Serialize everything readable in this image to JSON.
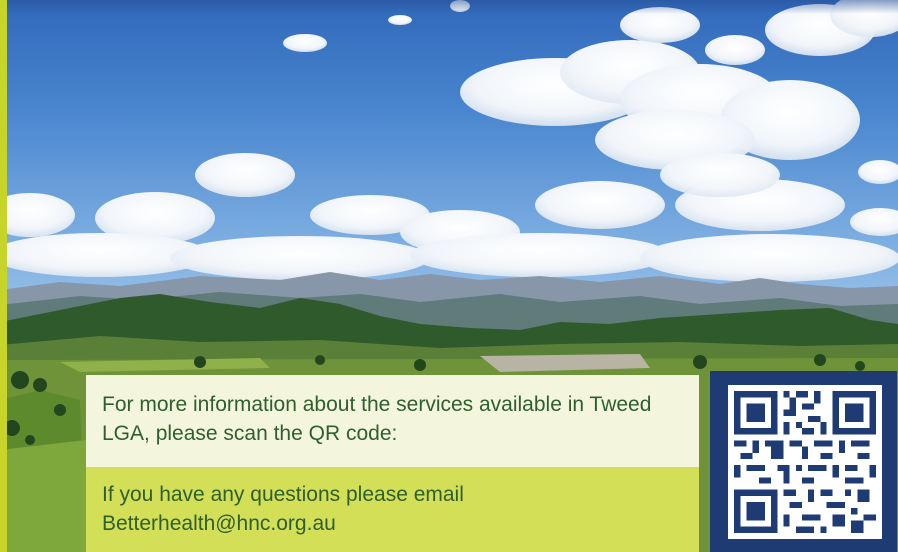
{
  "info": {
    "services_text": "For more information about the services available in Tweed LGA, please scan the QR code:",
    "contact_text": "If you have any questions please email Betterhealth@hnc.org.au"
  },
  "colors": {
    "accent_green": "#c7d52a",
    "panel_light": "#f3f6dc",
    "panel_green": "#d3df56",
    "text_green": "#2f5f2f",
    "qr_navy": "#1e3b73"
  },
  "images": {
    "hero_photo": "landscape-photo",
    "qr_code": "qr-code"
  }
}
